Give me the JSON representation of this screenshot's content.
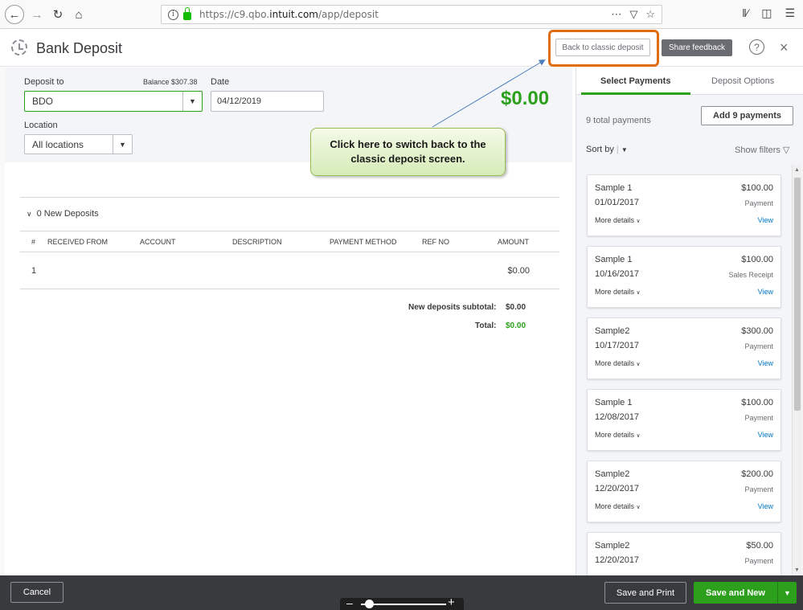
{
  "browser": {
    "url_prefix": "https://c9.qbo.",
    "url_domain": "intuit.com",
    "url_path": "/app/deposit"
  },
  "header": {
    "title": "Bank Deposit",
    "classic_button": "Back to classic deposit",
    "feedback_button": "Share feedback",
    "help_glyph": "?",
    "close_glyph": "×"
  },
  "form": {
    "deposit_to_label": "Deposit to",
    "balance": "Balance  $307.38",
    "deposit_to_value": "BDO",
    "date_label": "Date",
    "date_value": "04/12/2019",
    "location_label": "Location",
    "location_value": "All locations",
    "total_amount": "$0.00"
  },
  "deposits": {
    "section_label": "0 New Deposits",
    "columns": [
      "#",
      "RECEIVED FROM",
      "ACCOUNT",
      "DESCRIPTION",
      "PAYMENT METHOD",
      "REF NO",
      "AMOUNT"
    ],
    "rows": [
      {
        "num": "1",
        "amount": "$0.00"
      }
    ],
    "subtotal_label": "New deposits subtotal:",
    "subtotal_value": "$0.00",
    "total_label": "Total:",
    "total_value": "$0.00"
  },
  "callout": {
    "text": "Click here to switch back to the classic deposit screen."
  },
  "right_panel": {
    "tab_active": "Select Payments",
    "tab_inactive": "Deposit Options",
    "total_payments": "9 total payments",
    "add_button": "Add 9 payments",
    "sort_by": "Sort by",
    "show_filters": "Show filters",
    "more_details": "More details",
    "view": "View",
    "payments": [
      {
        "name": "Sample 1",
        "amount": "$100.00",
        "date": "01/01/2017",
        "type": "Payment"
      },
      {
        "name": "Sample 1",
        "amount": "$100.00",
        "date": "10/16/2017",
        "type": "Sales Receipt"
      },
      {
        "name": "Sample2",
        "amount": "$300.00",
        "date": "10/17/2017",
        "type": "Payment"
      },
      {
        "name": "Sample 1",
        "amount": "$100.00",
        "date": "12/08/2017",
        "type": "Payment"
      },
      {
        "name": "Sample2",
        "amount": "$200.00",
        "date": "12/20/2017",
        "type": "Payment"
      },
      {
        "name": "Sample2",
        "amount": "$50.00",
        "date": "12/20/2017",
        "type": "Payment"
      }
    ]
  },
  "footer": {
    "cancel": "Cancel",
    "save_print": "Save and Print",
    "save_new": "Save and New"
  },
  "colors": {
    "accent_green": "#2ca01c",
    "highlight_orange": "#e06c12",
    "link_blue": "#0077c5",
    "footer_bg": "#393a3d"
  },
  "icons": {
    "back": "back-arrow-icon",
    "forward": "forward-arrow-icon",
    "reload": "reload-icon",
    "home": "home-icon",
    "history": "history-icon",
    "help": "help-icon",
    "close": "close-icon"
  }
}
